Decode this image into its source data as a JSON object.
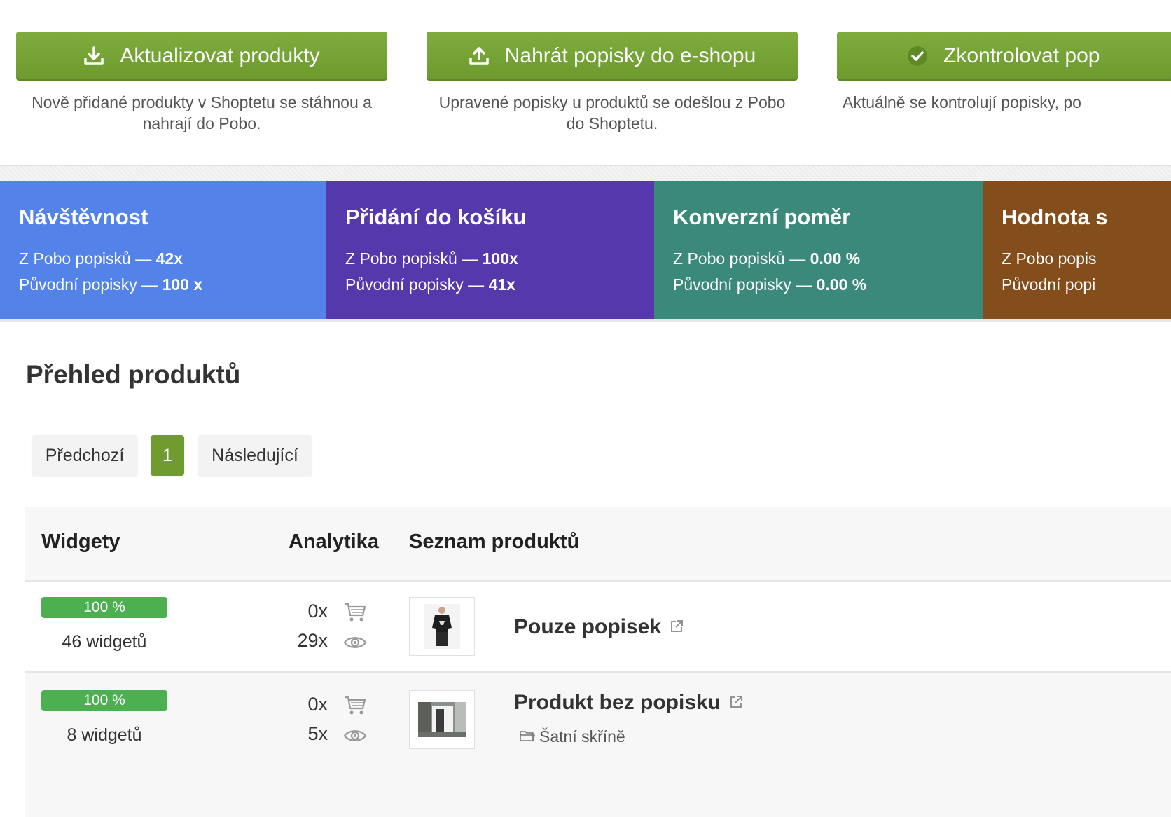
{
  "actions": [
    {
      "label": "Aktualizovat produkty",
      "icon": "download-icon",
      "desc": "Nově přidané produkty v Shoptetu se stáhnou a\nnahrají do Pobo."
    },
    {
      "label": "Nahrát popisky do e-shopu",
      "icon": "upload-icon",
      "desc": "Upravené popisky u produktů se odešlou z Pobo\ndo Shoptetu."
    },
    {
      "label": "Zkontrolovat pop",
      "icon": "check-icon",
      "desc": "Aktuálně se kontrolují popisky, po"
    }
  ],
  "stats": [
    {
      "title": "Návštěvnost",
      "l1_label": "Z Pobo popisků — ",
      "l1_value": "42x",
      "l2_label": "Původní popisky — ",
      "l2_value": "100 x",
      "color": "#5383e8"
    },
    {
      "title": "Přidání do košíku",
      "l1_label": "Z Pobo popisků — ",
      "l1_value": "100x",
      "l2_label": "Původní popisky — ",
      "l2_value": "41x",
      "color": "#5638ad"
    },
    {
      "title": "Konverzní poměr",
      "l1_label": "Z Pobo popisků — ",
      "l1_value": "0.00 %",
      "l2_label": "Původní popisky — ",
      "l2_value": "0.00 %",
      "color": "#3b897a"
    },
    {
      "title": "Hodnota s",
      "l1_label": "Z Pobo popis",
      "l1_value": "",
      "l2_label": "Původní popi",
      "l2_value": "",
      "color": "#844d1c"
    }
  ],
  "section_title": "Přehled produktů",
  "pagination": {
    "prev": "Předchozí",
    "current": "1",
    "next": "Následující"
  },
  "table": {
    "headers": {
      "widgets": "Widgety",
      "analytics": "Analytika",
      "products": "Seznam produktů"
    },
    "rows": [
      {
        "progress_label": "100 %",
        "progress": 1.0,
        "widgets": "46 widgetů",
        "cart": "0x",
        "views": "29x",
        "name": "Pouze popisek",
        "category": ""
      },
      {
        "progress_label": "100 %",
        "progress": 1.0,
        "widgets": "8 widgetů",
        "cart": "0x",
        "views": "5x",
        "name": "Produkt bez popisku",
        "category": "Šatní skříně"
      }
    ]
  },
  "colors": {
    "accent_green": "#6f9b2f",
    "progress_green": "#4caf50"
  }
}
